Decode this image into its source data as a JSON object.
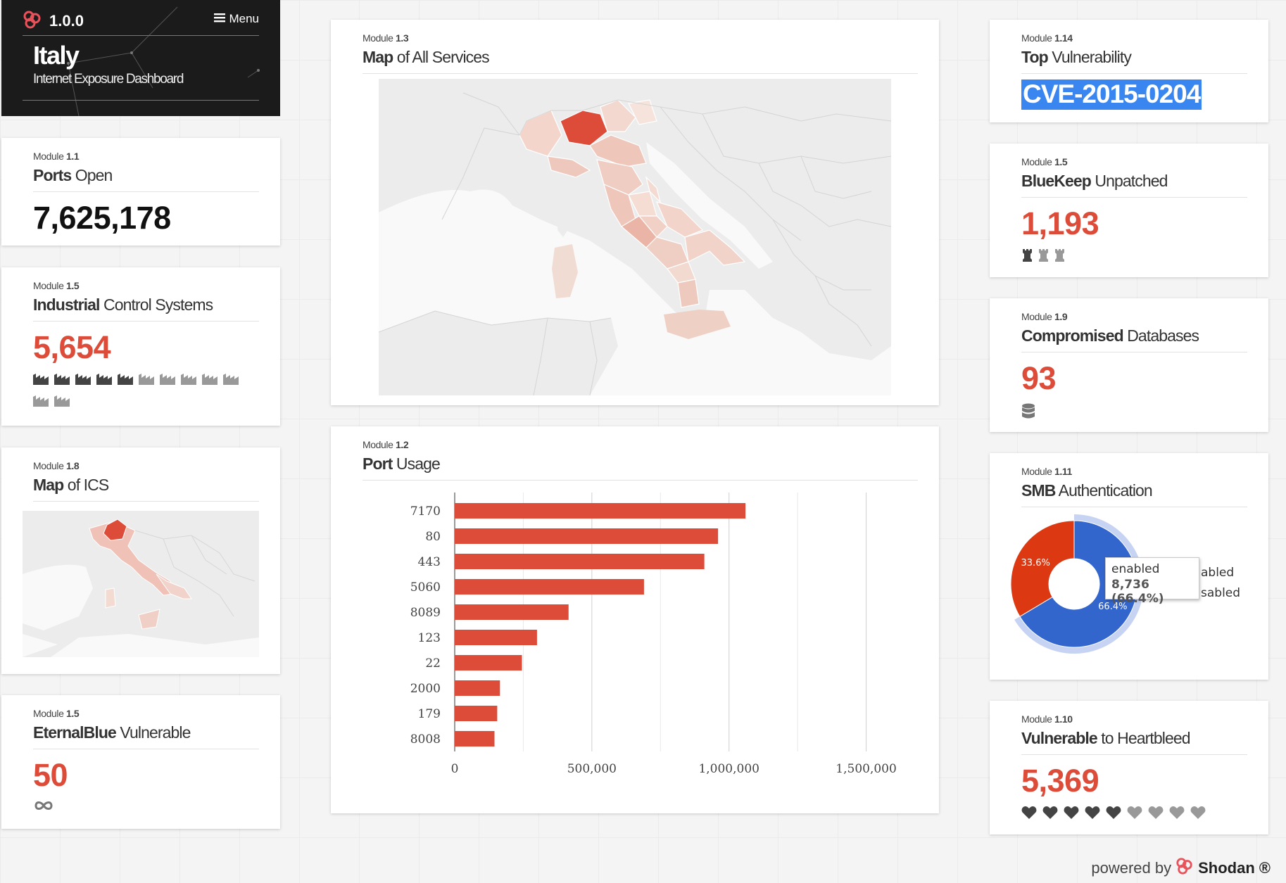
{
  "header": {
    "version": "1.0.0",
    "menu_label": "Menu",
    "country": "Italy",
    "subtitle": "Internet Exposure Dashboard"
  },
  "modules": {
    "ports_open": {
      "module": "Module",
      "num": "1.1",
      "title_bold": "Ports",
      "title_rest": " Open",
      "value": "7,625,178"
    },
    "ics": {
      "module": "Module",
      "num": "1.5",
      "title_bold": "Industrial",
      "title_rest": " Control Systems",
      "value": "5,654",
      "icons_dark": 5,
      "icons_light": 7
    },
    "map_ics": {
      "module": "Module",
      "num": "1.8",
      "title_bold": "Map",
      "title_rest": " of ICS"
    },
    "eternalblue": {
      "module": "Module",
      "num": "1.5",
      "title_bold": "EternalBlue",
      "title_rest": " Vulnerable",
      "value": "50"
    },
    "map_all": {
      "module": "Module",
      "num": "1.3",
      "title_bold": "Map",
      "title_rest": " of All Services"
    },
    "port_usage": {
      "module": "Module",
      "num": "1.2",
      "title_bold": "Port",
      "title_rest": " Usage"
    },
    "top_vuln": {
      "module": "Module",
      "num": "1.14",
      "title_bold": "Top",
      "title_rest": " Vulnerability",
      "value": "CVE-2015-0204"
    },
    "bluekeep": {
      "module": "Module",
      "num": "1.5",
      "title_bold": "BlueKeep",
      "title_rest": " Unpatched",
      "value": "1,193",
      "icons_dark": 1,
      "icons_light": 2
    },
    "databases": {
      "module": "Module",
      "num": "1.9",
      "title_bold": "Compromised",
      "title_rest": " Databases",
      "value": "93"
    },
    "smb": {
      "module": "Module",
      "num": "1.11",
      "title_bold": "SMB",
      "title_rest": " Authentication"
    },
    "heartbleed": {
      "module": "Module",
      "num": "1.10",
      "title_bold": "Vulnerable",
      "title_rest": " to Heartbleed",
      "value": "5,369",
      "icons_dark": 5,
      "icons_light": 4
    }
  },
  "smb_pie": {
    "slices": [
      {
        "name": "enabled",
        "value": 8736,
        "percent": 66.4,
        "color": "#3366cc",
        "label": "66.4%"
      },
      {
        "name": "disabled",
        "percent": 33.6,
        "color": "#dc3912",
        "label": "33.6%"
      }
    ],
    "legend_visible": [
      "abled",
      "sabled"
    ],
    "tooltip_title": "enabled",
    "tooltip_value": "8,736 (66.4%)"
  },
  "chart_data": {
    "type": "bar",
    "orientation": "horizontal",
    "title": "",
    "xlabel": "",
    "ylabel": "",
    "categories": [
      "7170",
      "80",
      "443",
      "5060",
      "8089",
      "123",
      "22",
      "2000",
      "179",
      "8008"
    ],
    "values": [
      1060000,
      960000,
      910000,
      690000,
      415000,
      300000,
      245000,
      165000,
      155000,
      145000
    ],
    "xlim": [
      0,
      1750000
    ],
    "x_ticks": [
      "0",
      "500,000",
      "1,000,000",
      "1,500,000"
    ],
    "bar_color": "#dd4b39",
    "grid": true
  },
  "footer": {
    "powered_by": "powered by",
    "brand": "Shodan",
    "registered": "®"
  },
  "colors": {
    "accent_red": "#dd4b39",
    "header_bg": "#1b1b1b",
    "selection_blue": "#3a86f0"
  }
}
